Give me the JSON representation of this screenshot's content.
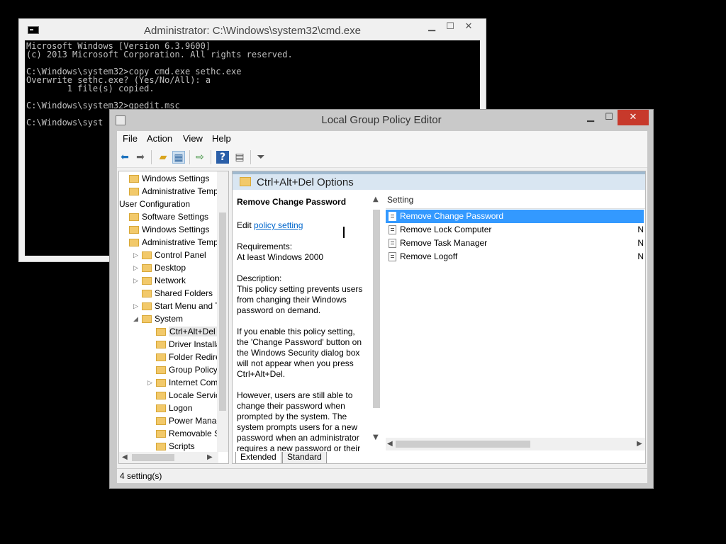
{
  "cmd": {
    "title": "Administrator: C:\\Windows\\system32\\cmd.exe",
    "icon": "console-icon",
    "lines": [
      "Microsoft Windows [Version 6.3.9600]",
      "(c) 2013 Microsoft Corporation. All rights reserved.",
      "",
      "C:\\Windows\\system32>copy cmd.exe sethc.exe",
      "Overwrite sethc.exe? (Yes/No/All): a",
      "        1 file(s) copied.",
      "",
      "C:\\Windows\\system32>gpedit.msc",
      "",
      "C:\\Windows\\syst"
    ],
    "buttons": {
      "minimize": "▁",
      "maximize": "☐",
      "close": "✕"
    }
  },
  "gpedit": {
    "title": "Local Group Policy Editor",
    "buttons": {
      "minimize": "▁",
      "maximize": "☐",
      "close": "✕"
    },
    "menu": [
      "File",
      "Action",
      "View",
      "Help"
    ],
    "toolbar_icons": [
      "back-icon",
      "forward-icon",
      "up-folder-icon",
      "show-hide-tree-icon",
      "export-list-icon",
      "help-icon",
      "show-hide-action-pane-icon",
      "filter-icon"
    ],
    "tree": [
      {
        "label": "Windows Settings",
        "indent": 0,
        "expander": "",
        "folder": true
      },
      {
        "label": "Administrative Templa",
        "indent": 0,
        "expander": "",
        "folder": true
      },
      {
        "label": "User Configuration",
        "indent": -1,
        "expander": "",
        "folder": false
      },
      {
        "label": "Software Settings",
        "indent": 0,
        "expander": "",
        "folder": true
      },
      {
        "label": "Windows Settings",
        "indent": 0,
        "expander": "",
        "folder": true
      },
      {
        "label": "Administrative Templa",
        "indent": 0,
        "expander": "",
        "folder": true
      },
      {
        "label": "Control Panel",
        "indent": 1,
        "expander": "▷",
        "folder": true
      },
      {
        "label": "Desktop",
        "indent": 1,
        "expander": "▷",
        "folder": true
      },
      {
        "label": "Network",
        "indent": 1,
        "expander": "▷",
        "folder": true
      },
      {
        "label": "Shared Folders",
        "indent": 1,
        "expander": "",
        "folder": true
      },
      {
        "label": "Start Menu and Tas",
        "indent": 1,
        "expander": "▷",
        "folder": true
      },
      {
        "label": "System",
        "indent": 1,
        "expander": "◢",
        "folder": true
      },
      {
        "label": "Ctrl+Alt+Del O",
        "indent": 2,
        "expander": "",
        "folder": true,
        "selected": true
      },
      {
        "label": "Driver Installati",
        "indent": 2,
        "expander": "",
        "folder": true
      },
      {
        "label": "Folder Redirect",
        "indent": 2,
        "expander": "",
        "folder": true
      },
      {
        "label": "Group Policy",
        "indent": 2,
        "expander": "",
        "folder": true
      },
      {
        "label": "Internet Comm",
        "indent": 2,
        "expander": "▷",
        "folder": true
      },
      {
        "label": "Locale Services",
        "indent": 2,
        "expander": "",
        "folder": true
      },
      {
        "label": "Logon",
        "indent": 2,
        "expander": "",
        "folder": true
      },
      {
        "label": "Power Manage",
        "indent": 2,
        "expander": "",
        "folder": true
      },
      {
        "label": "Removable Sto",
        "indent": 2,
        "expander": "",
        "folder": true
      },
      {
        "label": "Scripts",
        "indent": 2,
        "expander": "",
        "folder": true
      }
    ],
    "details_header": "Ctrl+Alt+Del Options",
    "extended": {
      "policy_title": "Remove Change Password",
      "edit_prefix": "Edit ",
      "edit_link": "policy setting ",
      "requirements_label": "Requirements:",
      "requirements_value": "At least Windows 2000",
      "description_label": "Description:",
      "description_paragraphs": [
        "This policy setting prevents users from changing their Windows password on demand.",
        "If you enable this policy setting, the 'Change Password' button on the Windows Security dialog box will not appear when you press Ctrl+Alt+Del.",
        "However, users are still able to change their password when prompted by the system. The system prompts users for a new password when an administrator requires a new password or their"
      ]
    },
    "list": {
      "column_setting": "Setting",
      "rows": [
        {
          "label": "Remove Change Password",
          "state": "",
          "selected": true
        },
        {
          "label": "Remove Lock Computer",
          "state": "N",
          "selected": false
        },
        {
          "label": "Remove Task Manager",
          "state": "N",
          "selected": false
        },
        {
          "label": "Remove Logoff",
          "state": "N",
          "selected": false
        }
      ]
    },
    "tabs": [
      "Extended",
      "Standard"
    ],
    "status": "4 setting(s)"
  }
}
